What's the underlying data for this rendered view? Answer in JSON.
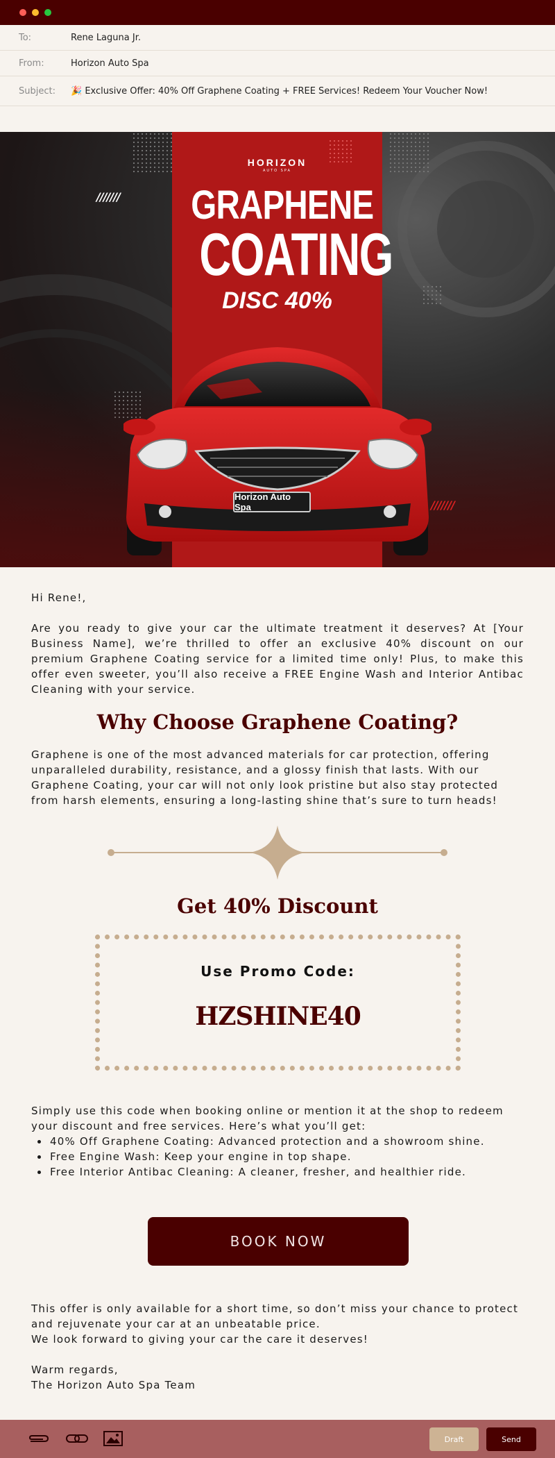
{
  "window": {
    "dots": [
      "#ff5f57",
      "#febc2e",
      "#28c840"
    ]
  },
  "header": {
    "to_label": "To:",
    "to_value": "Rene Laguna Jr.",
    "from_label": "From:",
    "from_value": "Horizon Auto Spa",
    "subject_label": "Subject:",
    "subject_emoji": "🎉",
    "subject_value": "Exclusive Offer: 40% Off Graphene Coating + FREE Services! Redeem Your Voucher Now!"
  },
  "banner": {
    "logo": "HORIZON",
    "logo_sub": "AUTO SPA",
    "heading_1": "GRAPHENE",
    "heading_2": "COATING",
    "discount": "DISC 40%",
    "plate": "Horizon Auto Spa",
    "stripes": "///////"
  },
  "body": {
    "greeting": "Hi Rene!,",
    "intro": "Are you ready to give your car the ultimate treatment it deserves? At [Your Business Name], we’re thrilled to offer an exclusive 40% discount on our premium Graphene Coating service for a limited time only! Plus, to make this offer even sweeter, you’ll also receive a FREE Engine Wash and Interior Antibac Cleaning with your service.",
    "why_title": "Why Choose Graphene Coating?",
    "why_text": "Graphene is one of the most advanced materials for car protection, offering unparalleled durability, resistance, and a glossy finish that lasts. With our Graphene Coating, your car will not only look pristine but also stay protected from harsh elements, ensuring a long-lasting shine that’s sure to turn heads!",
    "discount_title": "Get 40% Discount",
    "promo_label": "Use Promo Code:",
    "promo_code": "HZSHINE40",
    "use_code_text": "Simply use this code when booking online or mention it at the shop to redeem your discount and free services. Here’s what you’ll get:",
    "benefits": [
      "40% Off Graphene Coating: Advanced protection and a showroom shine.",
      "Free Engine Wash: Keep your engine in top shape.",
      "Free Interior Antibac Cleaning: A cleaner, fresher, and healthier ride."
    ],
    "book_button": "BOOK NOW",
    "closing_1": "This offer is only available for a short time, so don’t miss your chance to protect and rejuvenate your car at an unbeatable price.",
    "closing_2": "We look forward to giving your car the care it deserves!",
    "signoff_1": "Warm regards,",
    "signoff_2": "The Horizon Auto Spa Team"
  },
  "footer": {
    "icons": [
      "attachment-icon",
      "link-icon",
      "image-icon"
    ],
    "draft_label": "Draft",
    "send_label": "Send"
  },
  "colors": {
    "brand_dark": "#4a0000",
    "brand_red": "#b01818",
    "accent_tan": "#c6ad8f",
    "footer_bg": "#a85f5f",
    "page_bg": "#f7f3ee"
  }
}
